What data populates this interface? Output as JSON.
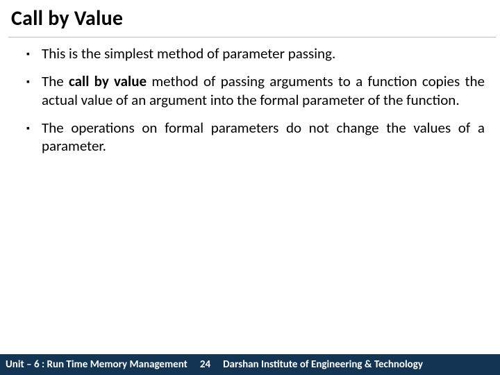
{
  "title": "Call by Value",
  "bullets": [
    {
      "pre": "This is the simplest method of parameter passing."
    },
    {
      "pre": "The ",
      "bold": "call by value ",
      "post": "method of passing arguments to a function copies the actual value of an argument into the formal parameter of the function."
    },
    {
      "pre": "The operations on formal parameters do not change the values of a parameter."
    }
  ],
  "footer": {
    "unit": "Unit – 6 : Run Time Memory Management",
    "page": "24",
    "institute": "Darshan Institute of Engineering & Technology"
  }
}
